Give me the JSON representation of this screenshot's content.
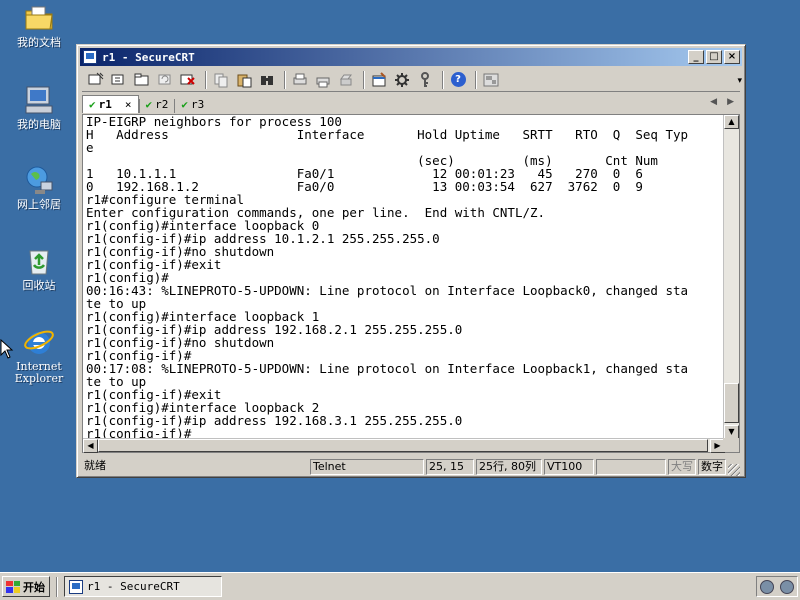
{
  "desktop": {
    "icons": [
      {
        "label": "我的文档",
        "icon": "folder-docs-icon"
      },
      {
        "label": "我的电脑",
        "icon": "computer-icon"
      },
      {
        "label": "网上邻居",
        "icon": "network-icon"
      },
      {
        "label": "回收站",
        "icon": "recycle-bin-icon"
      },
      {
        "label_line1": "Internet",
        "label_line2": "Explorer",
        "icon": "ie-icon"
      }
    ]
  },
  "window": {
    "title": "r1 - SecureCRT",
    "buttons": {
      "minimize": "_",
      "maximize": "□",
      "close": "×"
    }
  },
  "tabs": [
    {
      "label": "r1",
      "active": true,
      "close": "×"
    },
    {
      "label": "r2",
      "active": false
    },
    {
      "label": "r3",
      "active": false
    }
  ],
  "terminal": {
    "lines": [
      "IP-EIGRP neighbors for process 100",
      "H   Address                 Interface       Hold Uptime   SRTT   RTO  Q  Seq Typ",
      "e",
      "                                            (sec)         (ms)       Cnt Num",
      "1   10.1.1.1                Fa0/1             12 00:01:23   45   270  0  6",
      "0   192.168.1.2             Fa0/0             13 00:03:54  627  3762  0  9",
      "r1#configure terminal",
      "Enter configuration commands, one per line.  End with CNTL/Z.",
      "r1(config)#interface loopback 0",
      "r1(config-if)#ip address 10.1.2.1 255.255.255.0",
      "r1(config-if)#no shutdown",
      "r1(config-if)#exit",
      "r1(config)#",
      "00:16:43: %LINEPROTO-5-UPDOWN: Line protocol on Interface Loopback0, changed sta",
      "te to up",
      "r1(config)#interface loopback 1",
      "r1(config-if)#ip address 192.168.2.1 255.255.255.0",
      "r1(config-if)#no shutdown",
      "r1(config-if)#",
      "00:17:08: %LINEPROTO-5-UPDOWN: Line protocol on Interface Loopback1, changed sta",
      "te to up",
      "r1(config-if)#exit",
      "r1(config)#interface loopback 2",
      "r1(config-if)#ip address 192.168.3.1 255.255.255.0",
      "r1(config-if)#"
    ]
  },
  "statusbar": {
    "ready": "就绪",
    "protocol": "Telnet",
    "cursor_pos": "25, 15",
    "rows_cols": "25行, 80列",
    "emulation": "VT100",
    "caps": "大写",
    "num": "数字"
  },
  "taskbar": {
    "start_label": "开始",
    "task_label": "r1 - SecureCRT"
  }
}
